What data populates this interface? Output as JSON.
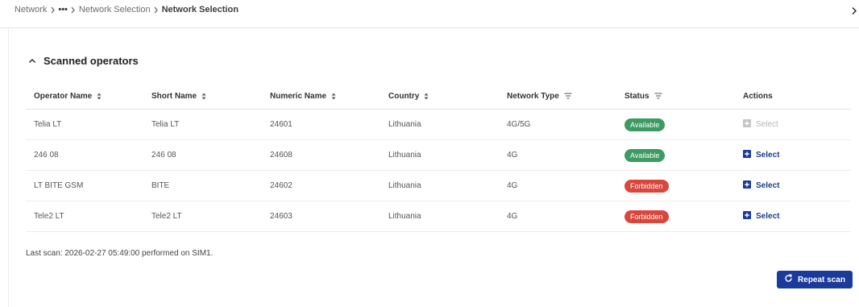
{
  "breadcrumb": {
    "items": [
      "Network",
      "•••",
      "Network Selection",
      "Network Selection"
    ]
  },
  "section": {
    "title": "Scanned operators"
  },
  "table": {
    "headers": [
      "Operator Name",
      "Short Name",
      "Numeric Name",
      "Country",
      "Network Type",
      "Status",
      "Actions"
    ],
    "rows": [
      {
        "operator": "Telia LT",
        "short": "Telia LT",
        "numeric": "24601",
        "country": "Lithuania",
        "type": "4G/5G",
        "status": "Available",
        "action": "Select"
      },
      {
        "operator": "246 08",
        "short": "246 08",
        "numeric": "24608",
        "country": "Lithuania",
        "type": "4G",
        "status": "Available",
        "action": "Select"
      },
      {
        "operator": "LT BITE GSM",
        "short": "BITE",
        "numeric": "24602",
        "country": "Lithuania",
        "type": "4G",
        "status": "Forbidden",
        "action": "Select"
      },
      {
        "operator": "Tele2 LT",
        "short": "Tele2 LT",
        "numeric": "24603",
        "country": "Lithuania",
        "type": "4G",
        "status": "Forbidden",
        "action": "Select"
      }
    ]
  },
  "footer": {
    "last_scan": "Last scan: 2026-02-27 05:49:00 performed on SIM1.",
    "repeat_label": "Repeat scan"
  },
  "colors": {
    "available": "#3c9a63",
    "forbidden": "#d9473c",
    "primary": "#1a3a9c",
    "action_text": "#1d3c8f"
  },
  "icons": {
    "breadcrumb_separator": "chevron-right-icon",
    "collapse": "chevron-up-icon",
    "sort": "sort-icon",
    "filter": "filter-icon",
    "select": "plus-square-icon",
    "repeat": "refresh-icon",
    "panel": "chevron-right-icon"
  }
}
